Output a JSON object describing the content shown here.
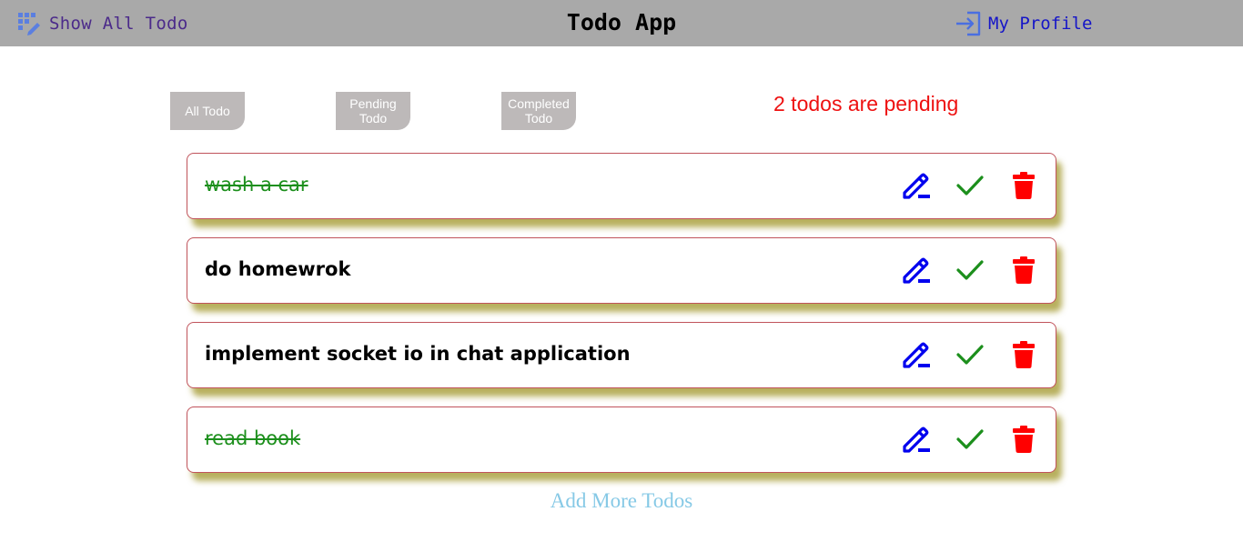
{
  "app": {
    "title": "Todo App"
  },
  "nav": {
    "show_all_label": "Show All Todo",
    "show_all_icon": "grid-edit-icon",
    "profile_label": "My Profile",
    "profile_icon": "sign-in-icon"
  },
  "filters": {
    "all": "All Todo",
    "pending": "Pending Todo",
    "completed": "Completed Todo"
  },
  "pending_text": "2 todos are pending",
  "todos": [
    {
      "text": "wash a car",
      "completed": true
    },
    {
      "text": "do homewrok",
      "completed": false
    },
    {
      "text": "implement socket io in chat application",
      "completed": false
    },
    {
      "text": "read book",
      "completed": true
    }
  ],
  "add_more_label": "Add More Todos",
  "colors": {
    "navbar": "#a9a9a9",
    "edit": "#0000ee",
    "check": "#1c8f1c",
    "delete": "#ff0000",
    "pending_text": "#ee1111",
    "add_more": "#86c9e6"
  }
}
